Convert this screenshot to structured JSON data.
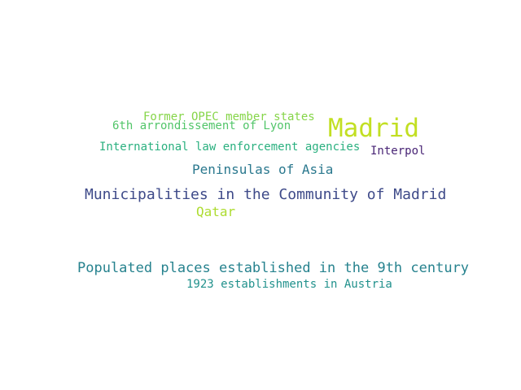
{
  "words": [
    {
      "text": "Madrid",
      "color": "#c2df23"
    },
    {
      "text": "Former OPEC member states",
      "color": "#86d549"
    },
    {
      "text": "6th arrondissement of Lyon",
      "color": "#52c569"
    },
    {
      "text": "International law enforcement agencies",
      "color": "#2ab07f"
    },
    {
      "text": "Interpol",
      "color": "#482475"
    },
    {
      "text": "Peninsulas of Asia",
      "color": "#2a788e"
    },
    {
      "text": "Municipalities in the Community of Madrid",
      "color": "#3e4a89"
    },
    {
      "text": "Qatar",
      "color": "#addc30"
    },
    {
      "text": "Populated places established in the 9th century",
      "color": "#26828e"
    },
    {
      "text": "1923 establishments in Austria",
      "color": "#21918c"
    }
  ]
}
